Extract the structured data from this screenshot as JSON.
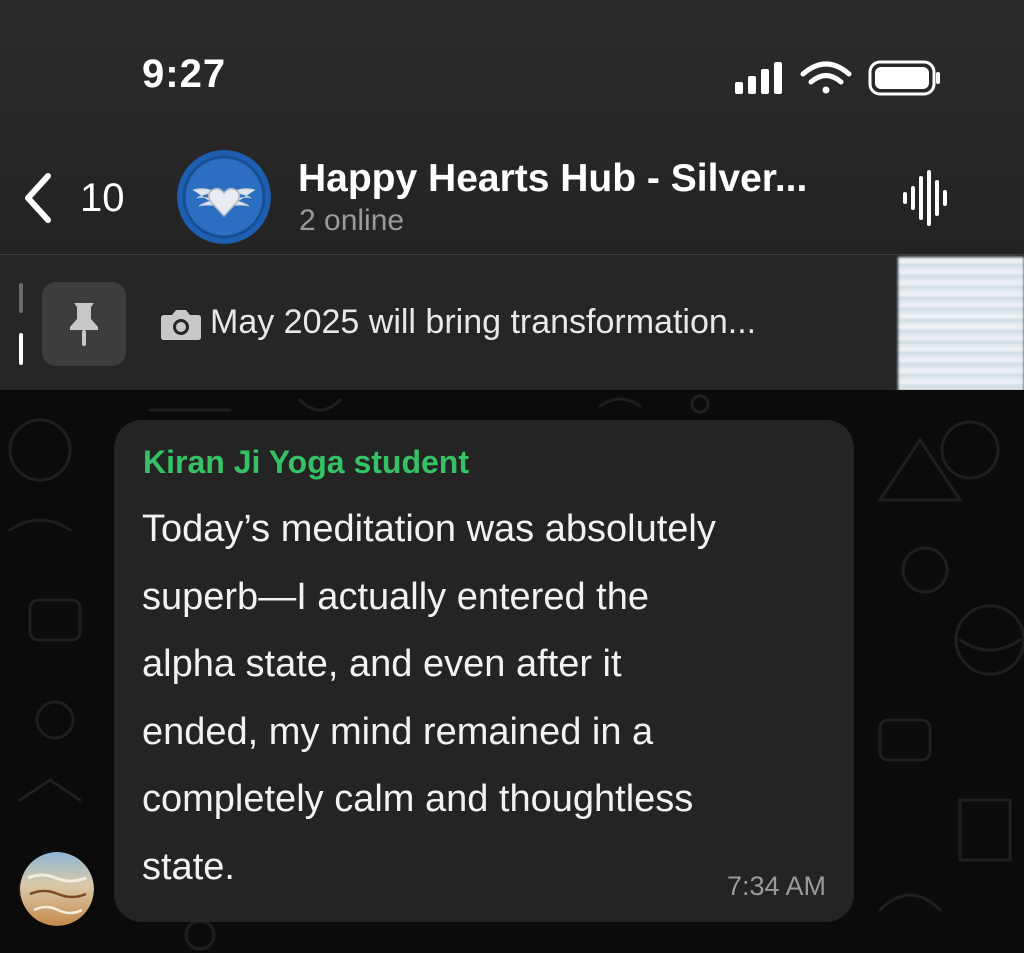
{
  "status_bar": {
    "time": "9:27",
    "signal_icon": "cellular-signal-icon",
    "wifi_icon": "wifi-icon",
    "battery_icon": "battery-icon"
  },
  "nav": {
    "back_icon": "chevron-left-icon",
    "back_count": "10",
    "group_avatar_icon": "heart-wings-logo",
    "title": "Happy Hearts Hub - Silver...",
    "subtitle": "2 online",
    "voice_icon": "voice-waveform-icon"
  },
  "pinned": {
    "pin_icon": "pushpin-icon",
    "camera_icon": "camera-icon",
    "text": "May 2025 will bring transformation..."
  },
  "message": {
    "sender": "Kiran Ji Yoga student",
    "lines": [
      "Today’s meditation was absolutely",
      "superb—I actually entered the",
      "alpha state, and even after it",
      "ended, my mind remained in a",
      "completely calm and thoughtless",
      "state."
    ],
    "time": "7:34 AM"
  },
  "colors": {
    "accent_green": "#35c265",
    "bubble": "#242424",
    "header": "#2b2b2b",
    "background": "#0b0b0b"
  }
}
